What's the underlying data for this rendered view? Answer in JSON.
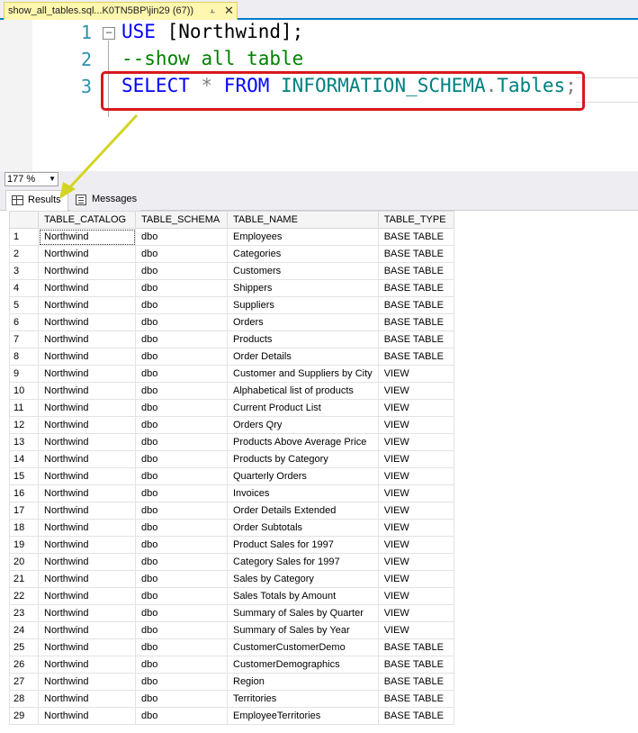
{
  "document_tab": {
    "title": "show_all_tables.sql...K0TN5BP\\jin29 (67))",
    "pin_icon": "pin-icon",
    "close_icon": "close-icon",
    "accent": "#007acc",
    "tab_bg": "#fff7b0"
  },
  "editor": {
    "lines": [
      {
        "number": "1",
        "tokens": [
          {
            "t": "USE",
            "k": "kw"
          },
          {
            "t": " [Northwind];",
            "k": "txt"
          }
        ]
      },
      {
        "number": "2",
        "tokens": [
          {
            "t": "--show all table",
            "k": "cm"
          }
        ]
      },
      {
        "number": "3",
        "tokens": [
          {
            "t": "SELECT",
            "k": "kw"
          },
          {
            "t": " * ",
            "k": "op"
          },
          {
            "t": "FROM",
            "k": "kw"
          },
          {
            "t": " INFORMATION_SCHEMA",
            "k": "sys"
          },
          {
            "t": ".",
            "k": "op"
          },
          {
            "t": "Tables",
            "k": "sys"
          },
          {
            "t": ";",
            "k": "op"
          }
        ]
      }
    ],
    "fold_icon": "collapse-icon",
    "highlight_color": "#d7191c",
    "arrow_color": "#d4d422"
  },
  "zoom": {
    "value": "177 %"
  },
  "result_tabs": [
    {
      "label": "Results",
      "icon": "grid-icon",
      "active": true
    },
    {
      "label": "Messages",
      "icon": "messages-icon",
      "active": false
    }
  ],
  "results": {
    "columns": [
      "TABLE_CATALOG",
      "TABLE_SCHEMA",
      "TABLE_NAME",
      "TABLE_TYPE"
    ],
    "rows": [
      [
        "1",
        "Northwind",
        "dbo",
        "Employees",
        "BASE TABLE"
      ],
      [
        "2",
        "Northwind",
        "dbo",
        "Categories",
        "BASE TABLE"
      ],
      [
        "3",
        "Northwind",
        "dbo",
        "Customers",
        "BASE TABLE"
      ],
      [
        "4",
        "Northwind",
        "dbo",
        "Shippers",
        "BASE TABLE"
      ],
      [
        "5",
        "Northwind",
        "dbo",
        "Suppliers",
        "BASE TABLE"
      ],
      [
        "6",
        "Northwind",
        "dbo",
        "Orders",
        "BASE TABLE"
      ],
      [
        "7",
        "Northwind",
        "dbo",
        "Products",
        "BASE TABLE"
      ],
      [
        "8",
        "Northwind",
        "dbo",
        "Order Details",
        "BASE TABLE"
      ],
      [
        "9",
        "Northwind",
        "dbo",
        "Customer and Suppliers by City",
        "VIEW"
      ],
      [
        "10",
        "Northwind",
        "dbo",
        "Alphabetical list of products",
        "VIEW"
      ],
      [
        "11",
        "Northwind",
        "dbo",
        "Current Product List",
        "VIEW"
      ],
      [
        "12",
        "Northwind",
        "dbo",
        "Orders Qry",
        "VIEW"
      ],
      [
        "13",
        "Northwind",
        "dbo",
        "Products Above Average Price",
        "VIEW"
      ],
      [
        "14",
        "Northwind",
        "dbo",
        "Products by Category",
        "VIEW"
      ],
      [
        "15",
        "Northwind",
        "dbo",
        "Quarterly Orders",
        "VIEW"
      ],
      [
        "16",
        "Northwind",
        "dbo",
        "Invoices",
        "VIEW"
      ],
      [
        "17",
        "Northwind",
        "dbo",
        "Order Details Extended",
        "VIEW"
      ],
      [
        "18",
        "Northwind",
        "dbo",
        "Order Subtotals",
        "VIEW"
      ],
      [
        "19",
        "Northwind",
        "dbo",
        "Product Sales for 1997",
        "VIEW"
      ],
      [
        "20",
        "Northwind",
        "dbo",
        "Category Sales for 1997",
        "VIEW"
      ],
      [
        "21",
        "Northwind",
        "dbo",
        "Sales by Category",
        "VIEW"
      ],
      [
        "22",
        "Northwind",
        "dbo",
        "Sales Totals by Amount",
        "VIEW"
      ],
      [
        "23",
        "Northwind",
        "dbo",
        "Summary of Sales by Quarter",
        "VIEW"
      ],
      [
        "24",
        "Northwind",
        "dbo",
        "Summary of Sales by Year",
        "VIEW"
      ],
      [
        "25",
        "Northwind",
        "dbo",
        "CustomerCustomerDemo",
        "BASE TABLE"
      ],
      [
        "26",
        "Northwind",
        "dbo",
        "CustomerDemographics",
        "BASE TABLE"
      ],
      [
        "27",
        "Northwind",
        "dbo",
        "Region",
        "BASE TABLE"
      ],
      [
        "28",
        "Northwind",
        "dbo",
        "Territories",
        "BASE TABLE"
      ],
      [
        "29",
        "Northwind",
        "dbo",
        "EmployeeTerritories",
        "BASE TABLE"
      ]
    ]
  }
}
